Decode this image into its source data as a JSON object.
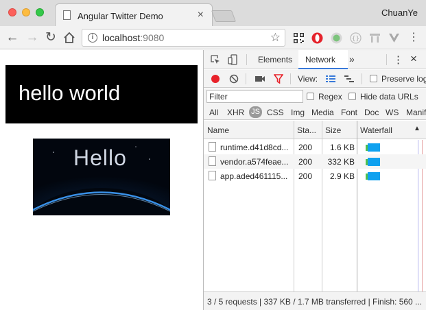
{
  "browser": {
    "tab_title": "Angular Twitter Demo",
    "user_name": "ChuanYe",
    "url_host": "localhost",
    "url_port": ":9080"
  },
  "page": {
    "heading": "hello world",
    "image_text": "Hello"
  },
  "devtools": {
    "tabs": [
      "Elements",
      "Network"
    ],
    "more_tabs": "»",
    "view_label": "View:",
    "preserve_log": "Preserve log",
    "filter_placeholder": "Filter",
    "regex": "Regex",
    "hide_data_urls": "Hide data URLs",
    "type_filters": [
      "All",
      "XHR",
      "JS",
      "CSS",
      "Img",
      "Media",
      "Font",
      "Doc",
      "WS",
      "Manifest"
    ],
    "columns": {
      "name": "Name",
      "status": "Sta...",
      "size": "Size",
      "waterfall": "Waterfall"
    },
    "requests": [
      {
        "name": "runtime.d41d8cd...",
        "status": "200",
        "size": "1.6 KB"
      },
      {
        "name": "vendor.a574feae...",
        "status": "200",
        "size": "332 KB"
      },
      {
        "name": "app.aded461115...",
        "status": "200",
        "size": "2.9 KB"
      }
    ],
    "summary": "3 / 5 requests | 337 KB / 1.7 MB transferred | Finish: 560 ..."
  }
}
